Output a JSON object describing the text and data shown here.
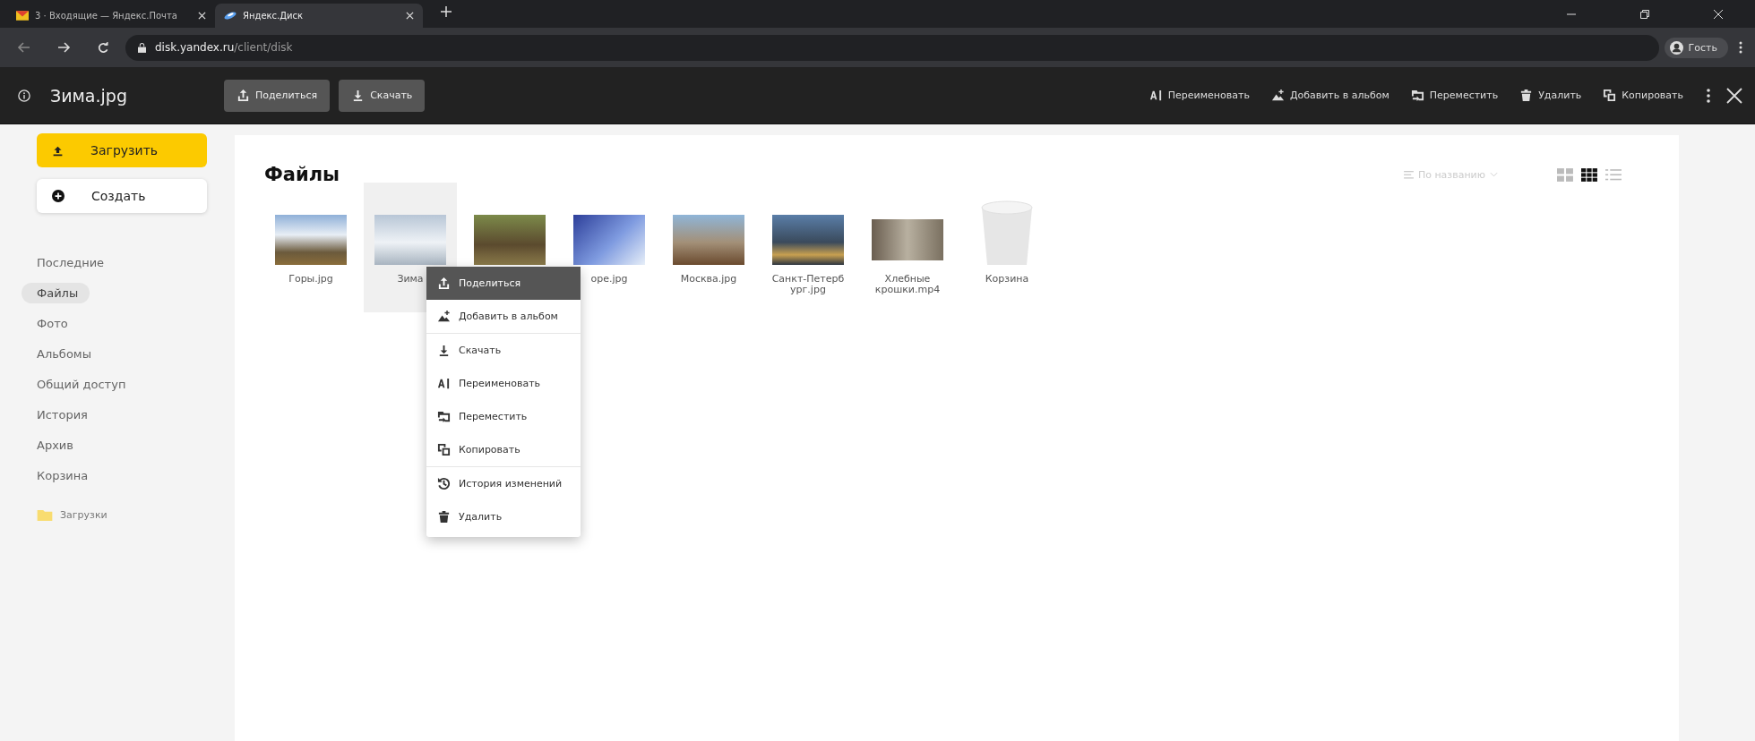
{
  "browser": {
    "tabs": [
      {
        "title": "3 · Входящие — Яндекс.Почта",
        "kind": "mail",
        "selected": false
      },
      {
        "title": "Яндекс.Диск",
        "kind": "disk",
        "selected": true
      }
    ],
    "url": {
      "host": "disk.yandex.ru",
      "path": "/client/disk"
    },
    "profile": "Гость"
  },
  "toolbar": {
    "filename": "Зима.jpg",
    "primary_actions": [
      {
        "label": "Поделиться",
        "kind": "share"
      },
      {
        "label": "Скачать",
        "kind": "download"
      }
    ],
    "actions": [
      {
        "label": "Переименовать",
        "kind": "rename"
      },
      {
        "label": "Добавить в альбом",
        "kind": "album"
      },
      {
        "label": "Переместить",
        "kind": "move"
      },
      {
        "label": "Удалить",
        "kind": "delete"
      },
      {
        "label": "Копировать",
        "kind": "copy"
      }
    ]
  },
  "sidebar": {
    "upload": "Загрузить",
    "create": "Создать",
    "items": [
      {
        "label": "Последние",
        "selected": false
      },
      {
        "label": "Файлы",
        "selected": true
      },
      {
        "label": "Фото",
        "selected": false
      },
      {
        "label": "Альбомы",
        "selected": false
      },
      {
        "label": "Общий доступ",
        "selected": false
      },
      {
        "label": "История",
        "selected": false
      },
      {
        "label": "Архив",
        "selected": false
      },
      {
        "label": "Корзина",
        "selected": false
      }
    ],
    "folders": [
      {
        "name": "Загрузки"
      }
    ]
  },
  "main": {
    "title": "Файлы",
    "sort": "По названию",
    "views": [
      {
        "kind": "tiles",
        "selected": false
      },
      {
        "kind": "grid",
        "selected": true
      },
      {
        "kind": "list",
        "selected": false
      }
    ],
    "files": [
      {
        "name": "Горы.jpg",
        "kind": "image",
        "selected": false
      },
      {
        "name": "Зима",
        "kind": "image",
        "selected": true
      },
      {
        "kind": "image",
        "selected": false
      },
      {
        "name": "оре.jpg",
        "kind": "image",
        "selected": false
      },
      {
        "name": "Москва.jpg",
        "kind": "image",
        "selected": false
      },
      {
        "name": "Санкт-Петерб\nург.jpg",
        "kind": "image",
        "selected": false
      },
      {
        "name": "Хлебные\nкрошки.mp4",
        "kind": "video",
        "selected": false
      },
      {
        "name": "Корзина",
        "kind": "trash",
        "selected": false
      }
    ]
  },
  "context_menu": [
    {
      "label": "Поделиться",
      "kind": "share",
      "selected": true,
      "separator_before": false
    },
    {
      "label": "Добавить в альбом",
      "kind": "album",
      "selected": false,
      "separator_before": false
    },
    {
      "label": "Скачать",
      "kind": "download",
      "selected": false,
      "separator_before": true
    },
    {
      "label": "Переименовать",
      "kind": "rename",
      "selected": false,
      "separator_before": false
    },
    {
      "label": "Переместить",
      "kind": "move",
      "selected": false,
      "separator_before": false
    },
    {
      "label": "Копировать",
      "kind": "copy",
      "selected": false,
      "separator_before": false
    },
    {
      "label": "История изменений",
      "kind": "history",
      "selected": false,
      "separator_before": true
    },
    {
      "label": "Удалить",
      "kind": "delete",
      "selected": false,
      "separator_before": false
    }
  ]
}
